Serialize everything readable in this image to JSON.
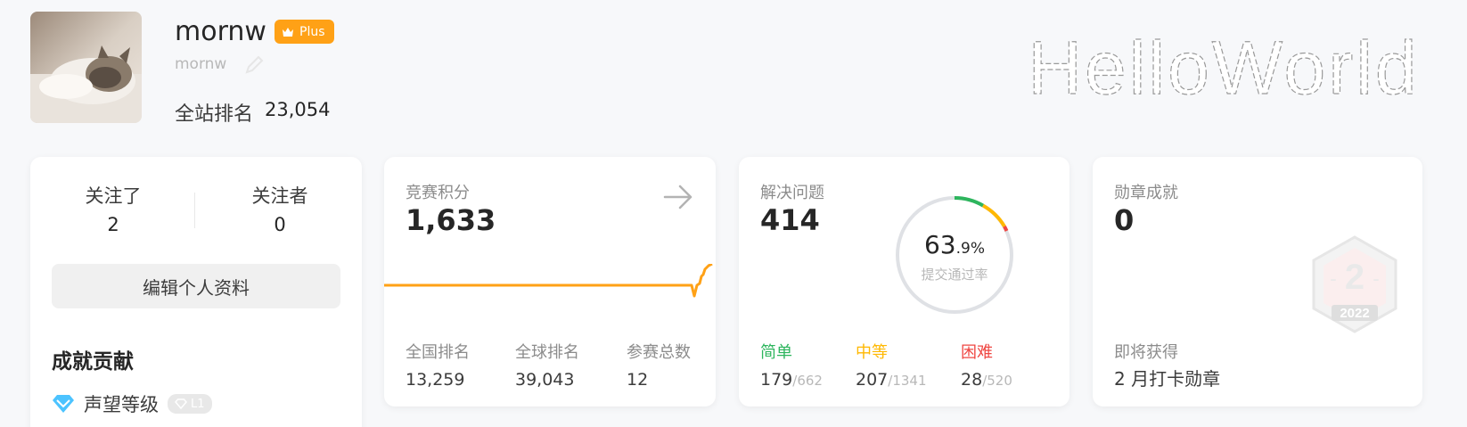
{
  "profile": {
    "username": "mornw",
    "handle": "mornw",
    "plus_badge": "Plus",
    "rank_label": "全站排名",
    "rank_value": "23,054",
    "banner_text": "HelloWorld"
  },
  "social": {
    "following_label": "关注了",
    "following_count": "2",
    "followers_label": "关注者",
    "followers_count": "0",
    "edit_profile_label": "编辑个人资料",
    "achievements_title": "成就贡献",
    "reputation_label": "声望等级",
    "reputation_level": "L1"
  },
  "contest": {
    "label": "竞赛积分",
    "rating": "1,633",
    "stats": [
      {
        "label": "全国排名",
        "value": "13,259"
      },
      {
        "label": "全球排名",
        "value": "39,043"
      },
      {
        "label": "参赛总数",
        "value": "12"
      }
    ]
  },
  "solved": {
    "label": "解决问题",
    "count": "414",
    "acceptance_int": "63",
    "acceptance_dec": ".9%",
    "acceptance_label": "提交通过率",
    "difficulties": [
      {
        "label": "简单",
        "solved": "179",
        "total": "/662",
        "color": "#2db55d"
      },
      {
        "label": "中等",
        "solved": "207",
        "total": "/1341",
        "color": "#ffb800"
      },
      {
        "label": "困难",
        "solved": "28",
        "total": "/520",
        "color": "#ef4743"
      }
    ]
  },
  "badges": {
    "label": "勋章成就",
    "count": "0",
    "upcoming_label": "即将获得",
    "upcoming_value": "2 月打卡勋章",
    "badge_number": "2",
    "badge_year": "2022"
  },
  "colors": {
    "accent": "#ffa116",
    "easy": "#2db55d",
    "medium": "#ffb800",
    "hard": "#ef4743",
    "rep_icon": "#4cc3ff"
  }
}
